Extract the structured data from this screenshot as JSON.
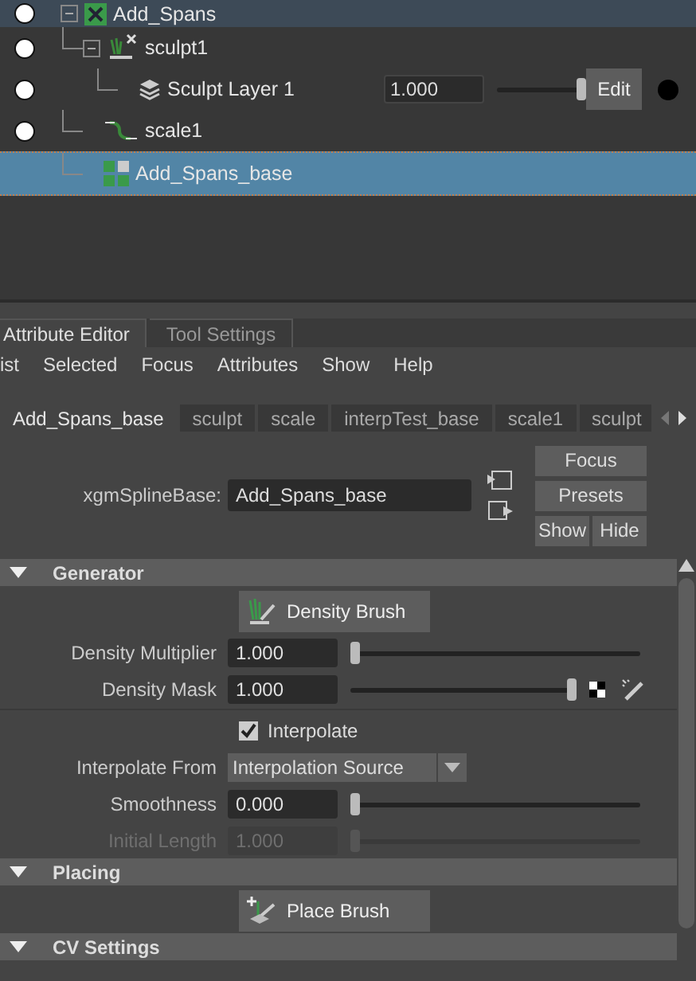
{
  "outliner": {
    "items": [
      {
        "name": "Add_Spans",
        "kind": "spline",
        "visibility": true,
        "expanded": true,
        "selected": false,
        "highlighted": true,
        "children": [
          {
            "name": "sculpt1",
            "kind": "sculpt",
            "visibility": true,
            "expanded": true,
            "selected": false,
            "highlighted": false,
            "children": [
              {
                "name": "Sculpt Layer 1",
                "kind": "layer",
                "visibility": true,
                "selected": false,
                "highlighted": false,
                "value": "1.000",
                "level": 1,
                "button": "Edit"
              }
            ]
          },
          {
            "name": "scale1",
            "kind": "scale",
            "visibility": true,
            "selected": false,
            "highlighted": false
          },
          {
            "name": "Add_Spans_base",
            "kind": "base",
            "visibility": false,
            "selected": true,
            "highlighted": false
          }
        ]
      }
    ]
  },
  "panel_tabs": [
    {
      "label": "Attribute Editor",
      "selected": true
    },
    {
      "label": "Tool Settings",
      "selected": false
    }
  ],
  "menu": [
    "ist",
    "Selected",
    "Focus",
    "Attributes",
    "Show",
    "Help"
  ],
  "node_tabs": [
    {
      "label": "Add_Spans_base",
      "selected": true
    },
    {
      "label": "sculpt",
      "selected": false
    },
    {
      "label": "scale",
      "selected": false
    },
    {
      "label": "interpTest_base",
      "selected": false
    },
    {
      "label": "scale1",
      "selected": false
    },
    {
      "label": "sculpt",
      "selected": false
    }
  ],
  "node": {
    "label": "xgmSplineBase:",
    "value": "Add_Spans_base",
    "buttons": [
      "Focus",
      "Presets",
      "Show",
      "Hide"
    ]
  },
  "sections": [
    {
      "title": "Generator",
      "expanded": true,
      "rows": [
        {
          "kind": "button",
          "label": "Density Brush"
        },
        {
          "kind": "slider",
          "label": "Density Multiplier",
          "value": "1.000",
          "level": 0,
          "disabled": false
        },
        {
          "kind": "slider",
          "label": "Density Mask",
          "value": "1.000",
          "level": 1,
          "disabled": false,
          "mask": true
        },
        {
          "kind": "checkbox",
          "label": "Interpolate",
          "checked": true
        },
        {
          "kind": "dropdown",
          "label": "Interpolate From",
          "value": "Interpolation Source"
        },
        {
          "kind": "slider",
          "label": "Smoothness",
          "value": "0.000",
          "level": 0,
          "disabled": false
        },
        {
          "kind": "slider",
          "label": "Initial Length",
          "value": "1.000",
          "level": 0,
          "disabled": true
        }
      ]
    },
    {
      "title": "Placing",
      "expanded": true,
      "rows": [
        {
          "kind": "button",
          "label": "Place Brush"
        }
      ]
    },
    {
      "title": "CV Settings",
      "expanded": true
    }
  ]
}
